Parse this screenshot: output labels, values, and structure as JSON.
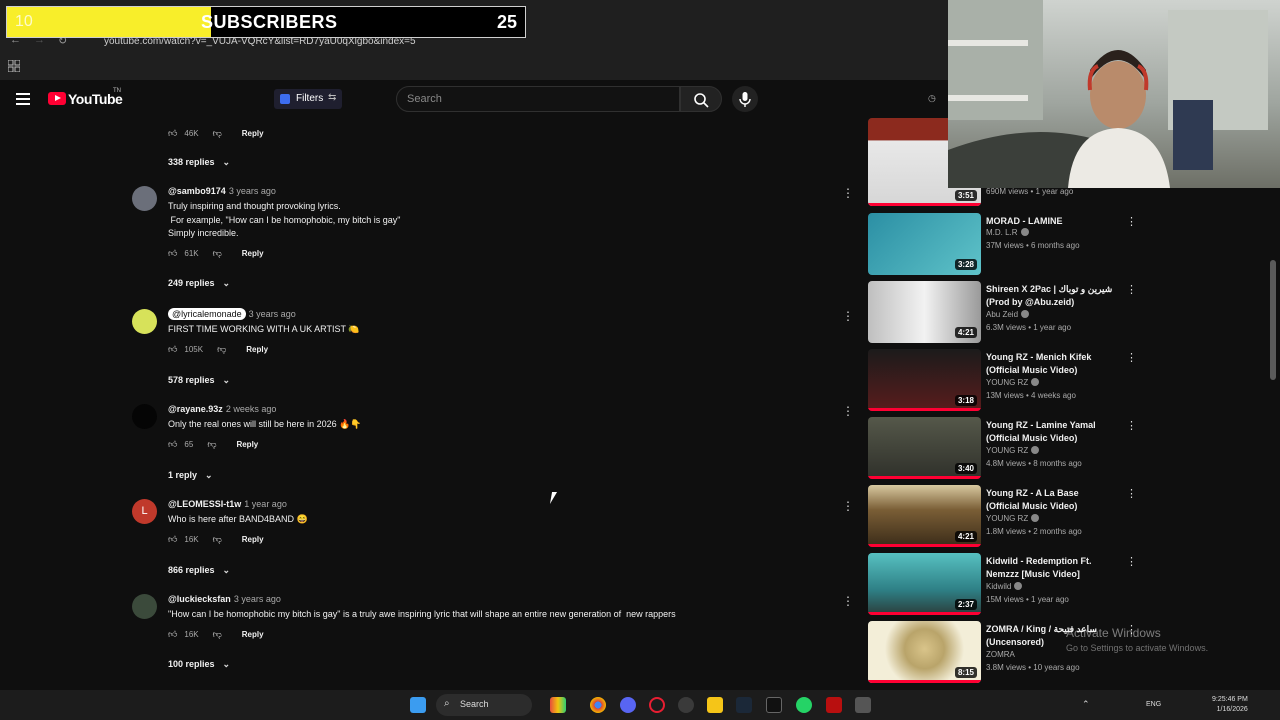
{
  "sub_counter": {
    "left_value": "10",
    "title": "SUBSCRIBERS",
    "right_value": "25",
    "progress": 0.39
  },
  "browser": {
    "url": "youtube.com/watch?v=_VUJA-VQRcY&list=RD7yaU0qXlgbo&index=5"
  },
  "header": {
    "logo_text": "YouTube",
    "logo_sup": "TN",
    "filters_label": "Filters",
    "search_placeholder": "Search"
  },
  "comments": [
    {
      "author": "",
      "time": "",
      "text": "",
      "likes": "46K",
      "reply": "Reply",
      "replies": "338 replies"
    },
    {
      "author": "@sambo9174",
      "time": "3 years ago",
      "text": "Truly inspiring and thought provoking lyrics.\n For example, \"How can I be homophobic, my bitch is gay\"\nSimply incredible.",
      "likes": "61K",
      "reply": "Reply",
      "replies": "249 replies"
    },
    {
      "author": "@lyricalemonade",
      "time": "3 years ago",
      "text": "FIRST TIME WORKING WITH A UK ARTIST 🍋",
      "likes": "105K",
      "reply": "Reply",
      "replies": "578 replies"
    },
    {
      "author": "@rayane.93z",
      "time": "2 weeks ago",
      "text": "Only the real ones will still be here in 2026 🔥👇",
      "likes": "65",
      "reply": "Reply",
      "replies": "1 reply"
    },
    {
      "author": "@LEOMESSI-t1w",
      "time": "1 year ago",
      "text": "Who is here after BAND4BAND 😄",
      "likes": "16K",
      "reply": "Reply",
      "replies": "866 replies",
      "avatar_letter": "L"
    },
    {
      "author": "@luckiecksfan",
      "time": "3 years ago",
      "text": "\"How can I be homophobic my bitch is gay\" is a truly awe inspiring lyric that will shape an entire new generation of  new rappers",
      "likes": "16K",
      "reply": "Reply",
      "replies": "100 replies"
    }
  ],
  "sidebar": [
    {
      "title": "",
      "channel": "",
      "views": "690M views • 1 year ago",
      "duration": "3:51",
      "thumb_color": "#e6e6e6"
    },
    {
      "title": "MORAD - LAMINE",
      "channel": "M.D. L.R",
      "views": "37M views • 6 months ago",
      "duration": "3:28",
      "thumb_color": "#3fa3b8"
    },
    {
      "title": "Shireen X 2Pac | شيرين و توباك (Prod by @Abu.zeid)",
      "channel": "Abu Zeid",
      "views": "6.3M views • 1 year ago",
      "duration": "4:21",
      "thumb_color": "#d9d9d9"
    },
    {
      "title": "Young RZ - Menich Kifek (Official Music Video)",
      "channel": "YOUNG RZ",
      "views": "13M views • 4 weeks ago",
      "duration": "3:18",
      "thumb_color": "#3a1717"
    },
    {
      "title": "Young RZ - Lamine Yamal (Official Music Video)",
      "channel": "YOUNG RZ",
      "views": "4.8M views • 8 months ago",
      "duration": "3:40",
      "thumb_color": "#4a4a3a"
    },
    {
      "title": "Young RZ - A La Base (Official Music Video)",
      "channel": "YOUNG RZ",
      "views": "1.8M views • 2 months ago",
      "duration": "4:21",
      "thumb_color": "#6a5a3a"
    },
    {
      "title": "Kidwild - Redemption Ft. Nemzzz [Music Video]",
      "channel": "Kidwild",
      "views": "15M views • 1 year ago",
      "duration": "2:37",
      "thumb_color": "#2c8a8a"
    },
    {
      "title": "ZOMRA / King / ساعد فتيحة (Uncensored)",
      "channel": "ZOMRA",
      "views": "3.8M views • 10 years ago",
      "duration": "8:15",
      "thumb_color": "#efe8cc"
    }
  ],
  "taskbar": {
    "search_label": "Search",
    "lang": "ENG",
    "time": "9:25:46 PM",
    "date": "1/16/2026"
  },
  "watermark": {
    "title": "Activate Windows",
    "subtitle": "Go to Settings to activate Windows."
  },
  "colors": {
    "accent": "#ff0033",
    "sub_fill": "#f8ee2a",
    "bg": "#0f0f0f"
  }
}
